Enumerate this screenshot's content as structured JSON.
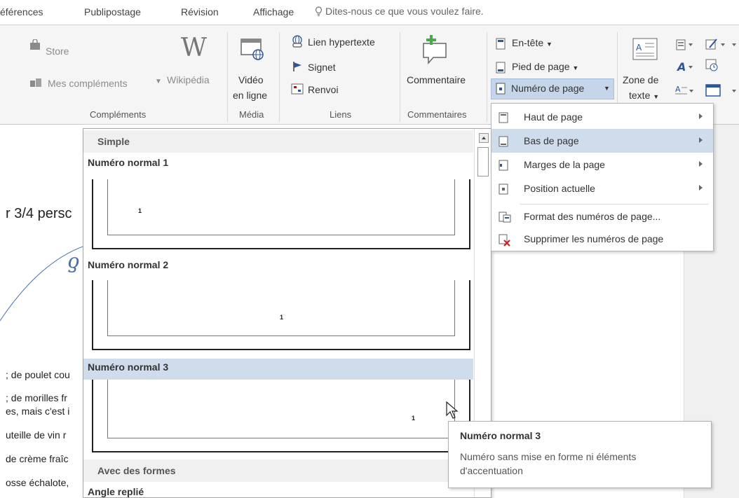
{
  "tabs": {
    "items": [
      "éférences",
      "Publipostage",
      "Révision",
      "Affichage"
    ],
    "tell_me": "Dites-nous ce que vous voulez faire."
  },
  "ribbon": {
    "complements": {
      "store": "Store",
      "mes_complements": "Mes compléments",
      "wikipedia": "Wikipédia",
      "group": "Compléments"
    },
    "media": {
      "video_line1": "Vidéo",
      "video_line2": "en ligne",
      "group": "Média"
    },
    "liens": {
      "hyperlink": "Lien hypertexte",
      "signet": "Signet",
      "renvoi": "Renvoi",
      "group": "Liens"
    },
    "commentaires": {
      "commentaire": "Commentaire",
      "group": "Commentaires"
    },
    "entete": {
      "en_tete": "En-tête",
      "pied_de_page": "Pied de page",
      "numero_de_page": "Numéro de page"
    },
    "texte": {
      "zone_line1": "Zone de",
      "zone_line2": "texte"
    }
  },
  "document": {
    "heading": "r 3/4 persc",
    "lines": [
      "; de poulet cou",
      "; de morilles fr",
      "es, mais c'est i",
      "uteille de vin r",
      "de crème fraîc",
      "osse échalote,"
    ]
  },
  "gallery": {
    "section_simple": "Simple",
    "items": [
      "Numéro normal 1",
      "Numéro normal 2",
      "Numéro normal 3"
    ],
    "page_number": "1",
    "section_formes": "Avec des formes",
    "next_item": "Angle replié"
  },
  "submenu": {
    "items": [
      {
        "label": "Haut de page"
      },
      {
        "label": "Bas de page"
      },
      {
        "label": "Marges de la page"
      },
      {
        "label": "Position actuelle"
      },
      {
        "label": "Format des numéros de page..."
      },
      {
        "label": "Supprimer les numéros de page"
      }
    ]
  },
  "tooltip": {
    "title": "Numéro normal 3",
    "description": "Numéro sans mise en forme ni éléments d'accentuation"
  },
  "colors": {
    "selection": "#cfdcec",
    "ribbon_bg": "#f5f5f5",
    "accent_blue": "#2b579a"
  }
}
